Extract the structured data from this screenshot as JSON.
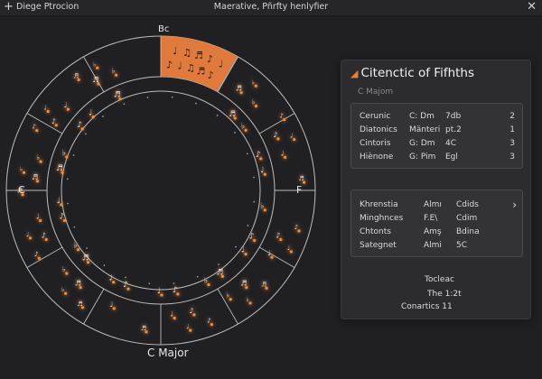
{
  "titlebar": {
    "left_icon": "plus-icon",
    "app_name": "Diege Ptrocion",
    "window_title": "Maerative, Pñrfty henlyfier",
    "close_icon": "close-icon"
  },
  "wheel": {
    "top_label": "Bc",
    "left_label": "C",
    "right_label": "F",
    "key_label": "C Major",
    "highlight_color": "#e07a3c",
    "glow_color": "#ff8a2a",
    "ring_color": "#bdbdbd"
  },
  "panel": {
    "icon": "music-note-icon",
    "title": "Citenctic of Fifhths",
    "subtitle": "C Majom",
    "card1_rows": [
      {
        "name": "Cerunic",
        "chord": "C: Dm",
        "value": "7db",
        "count": "2"
      },
      {
        "name": "Diatonics",
        "chord": "Mänteri",
        "value": "pt.2",
        "count": "1"
      },
      {
        "name": "Cintoris",
        "chord": "G: Dm",
        "value": "4C",
        "count": "3"
      },
      {
        "name": "Hiènone",
        "chord": "G: Pim",
        "value": "Egl",
        "count": "3"
      }
    ],
    "card2_rows": [
      {
        "name": "Khrenstia",
        "chord": "Almı",
        "value": "Cdids"
      },
      {
        "name": "Minghnces",
        "chord": "F.E\\",
        "value": "Cdim"
      },
      {
        "name": "Chtonts",
        "chord": "Amş",
        "value": "Bdina"
      },
      {
        "name": "Sategnet",
        "chord": "Almi",
        "value": "5C"
      }
    ],
    "expand_icon": "chevron-right-icon",
    "summary": {
      "line1": "Tocleac",
      "line2": "The  1:2t",
      "line3": "Conartics  11"
    }
  }
}
